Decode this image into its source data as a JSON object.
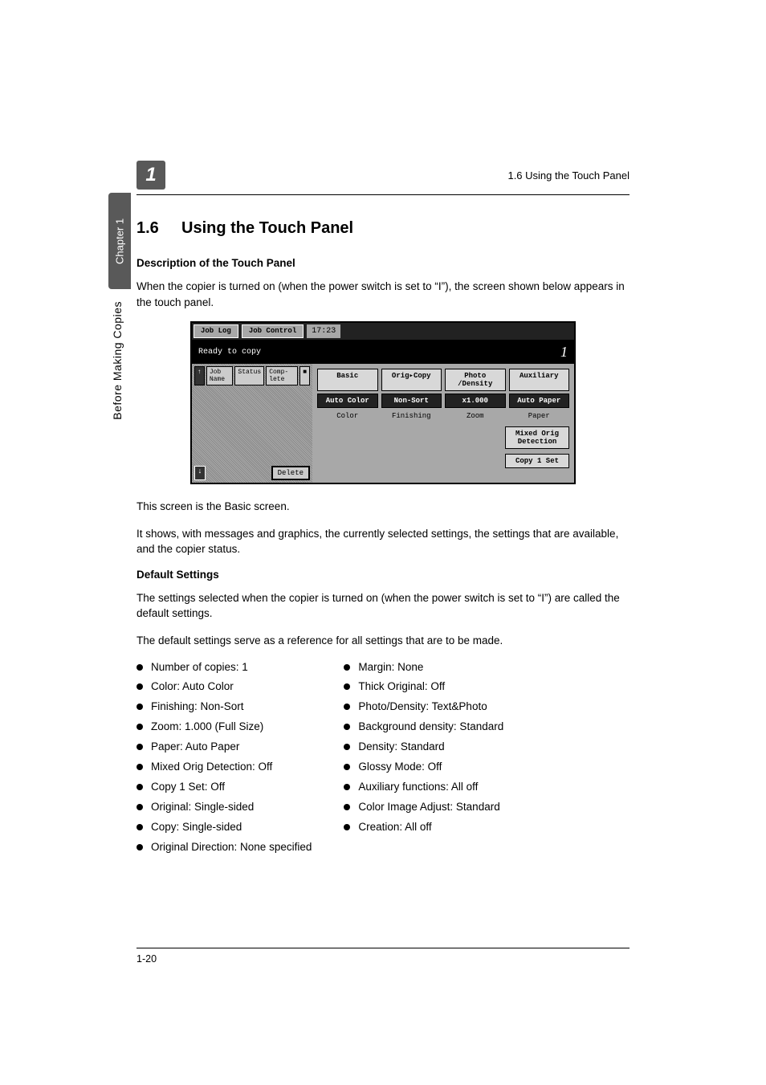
{
  "running_header": "1.6 Using the Touch Panel",
  "chapter_badge": "1",
  "side_tab": "Chapter 1",
  "side_label": "Before Making Copies",
  "section_number": "1.6",
  "section_title": "Using the Touch Panel",
  "sub1": "Description of the Touch Panel",
  "para1": "When the copier is turned on (when the power switch is set to “I”), the screen shown below appears in the touch panel.",
  "screenshot": {
    "tab_job_log": "Job\nLog",
    "tab_job_control": "Job\nControl",
    "time": "17:23",
    "status_msg": "Ready to copy",
    "copy_count": "1",
    "left_hdr_arrow_up": "↑",
    "left_hdr_job_name": "Job\nName",
    "left_hdr_status": "Status",
    "left_hdr_complete": "Comp-\nlete",
    "left_hdr_icon": "■",
    "arrow_down": "↓",
    "delete": "Delete",
    "tabs": {
      "basic": "Basic",
      "orig": "Orig▸Copy",
      "photo": "Photo\n/Density",
      "aux": "Auxiliary"
    },
    "row1": {
      "a": "Auto\nColor",
      "b": "Non-Sort",
      "c": "x1.000",
      "d": "Auto Paper"
    },
    "labels": {
      "a": "Color",
      "b": "Finishing",
      "c": "Zoom",
      "d": "Paper"
    },
    "tail1": "Mixed Orig\nDetection",
    "tail2": "Copy 1 Set"
  },
  "para2": "This screen is the Basic screen.",
  "para3": "It shows, with messages and graphics, the currently selected settings, the settings that are available, and the copier status.",
  "sub2": "Default Settings",
  "para4": "The settings selected when the copier is turned on (when the power switch is set to “I”) are called the default settings.",
  "para5": "The default settings serve as a reference for all settings that are to be made.",
  "left_list": [
    "Number of copies: 1",
    "Color: Auto Color",
    "Finishing: Non-Sort",
    "Zoom: 1.000 (Full Size)",
    "Paper: Auto Paper",
    "Mixed Orig Detection: Off",
    "Copy 1 Set: Off",
    "Original: Single-sided",
    "Copy: Single-sided",
    "Original Direction: None specified"
  ],
  "right_list": [
    "Margin: None",
    "Thick Original: Off",
    "Photo/Density: Text&Photo",
    "Background density: Standard",
    "Density: Standard",
    "Glossy Mode: Off",
    "Auxiliary functions: All off",
    "Color Image Adjust: Standard",
    "Creation: All off"
  ],
  "page_number": "1-20"
}
